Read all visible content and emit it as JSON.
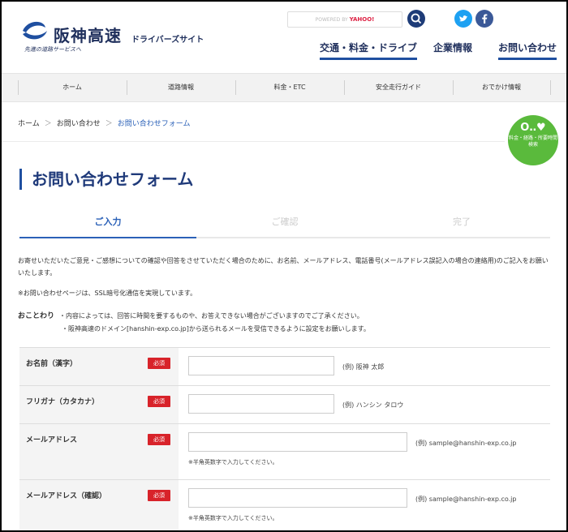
{
  "header": {
    "logo_text": "阪神高速",
    "logo_sub": "ドライバーズサイト",
    "logo_tag": "先進の道路サービスへ",
    "search_powered": "POWERED BY",
    "search_brand": "YAHOO!",
    "top_nav": [
      {
        "label": "交通・料金・ドライブ"
      },
      {
        "label": "企業情報"
      },
      {
        "label": "お問い合わせ"
      }
    ]
  },
  "menu": [
    {
      "label": "ホーム"
    },
    {
      "label": "道路情報"
    },
    {
      "label": "料金・ETC"
    },
    {
      "label": "安全走行ガイド"
    },
    {
      "label": "おでかけ情報"
    }
  ],
  "breadcrumb": {
    "items": [
      "ホーム",
      "お問い合わせ",
      "お問い合わせフォーム"
    ],
    "sep": "＞"
  },
  "route_button": {
    "icon": "O‥♥",
    "label": "料金・経路・所要時間検索"
  },
  "page_title": "お問い合わせフォーム",
  "steps": [
    {
      "label": "ご入力",
      "active": true
    },
    {
      "label": "ご確認",
      "active": false
    },
    {
      "label": "完了",
      "active": false
    }
  ],
  "intro": "お寄せいただいたご意見・ご感想についての確認や回答をさせていただく場合のために、お名前、メールアドレス、電話番号(メールアドレス誤記入の場合の連絡用)のご記入をお願いいたします。",
  "ssl_note": "※お問い合わせページは、SSL暗号化通信を実現しています。",
  "notice": {
    "label": "おことわり",
    "line1": "・内容によっては、回答に時間を要するものや、お答えできない場合がございますのでご了承ください。",
    "line2": "・阪神高速のドメイン[hanshin-exp.co.jp]から送られるメールを受信できるように設定をお願いします。"
  },
  "form": {
    "required_label": "必須",
    "fields": [
      {
        "label": "お名前（漢字）",
        "value": "",
        "example": "(例) 阪神 太郎",
        "hint": ""
      },
      {
        "label": "フリガナ（カタカナ）",
        "value": "",
        "example": "(例) ハンシン タロウ",
        "hint": ""
      },
      {
        "label": "メールアドレス",
        "value": "",
        "example": "(例) sample@hanshin-exp.co.jp",
        "hint": "※半角英数字で入力してください。"
      },
      {
        "label": "メールアドレス（確認）",
        "value": "",
        "example": "(例) sample@hanshin-exp.co.jp",
        "hint": "※半角英数字で入力してください。"
      }
    ]
  },
  "colors": {
    "brand": "#1f2f5c",
    "accent": "#2b61b8",
    "required": "#d8232a",
    "route": "#5aba3c"
  }
}
